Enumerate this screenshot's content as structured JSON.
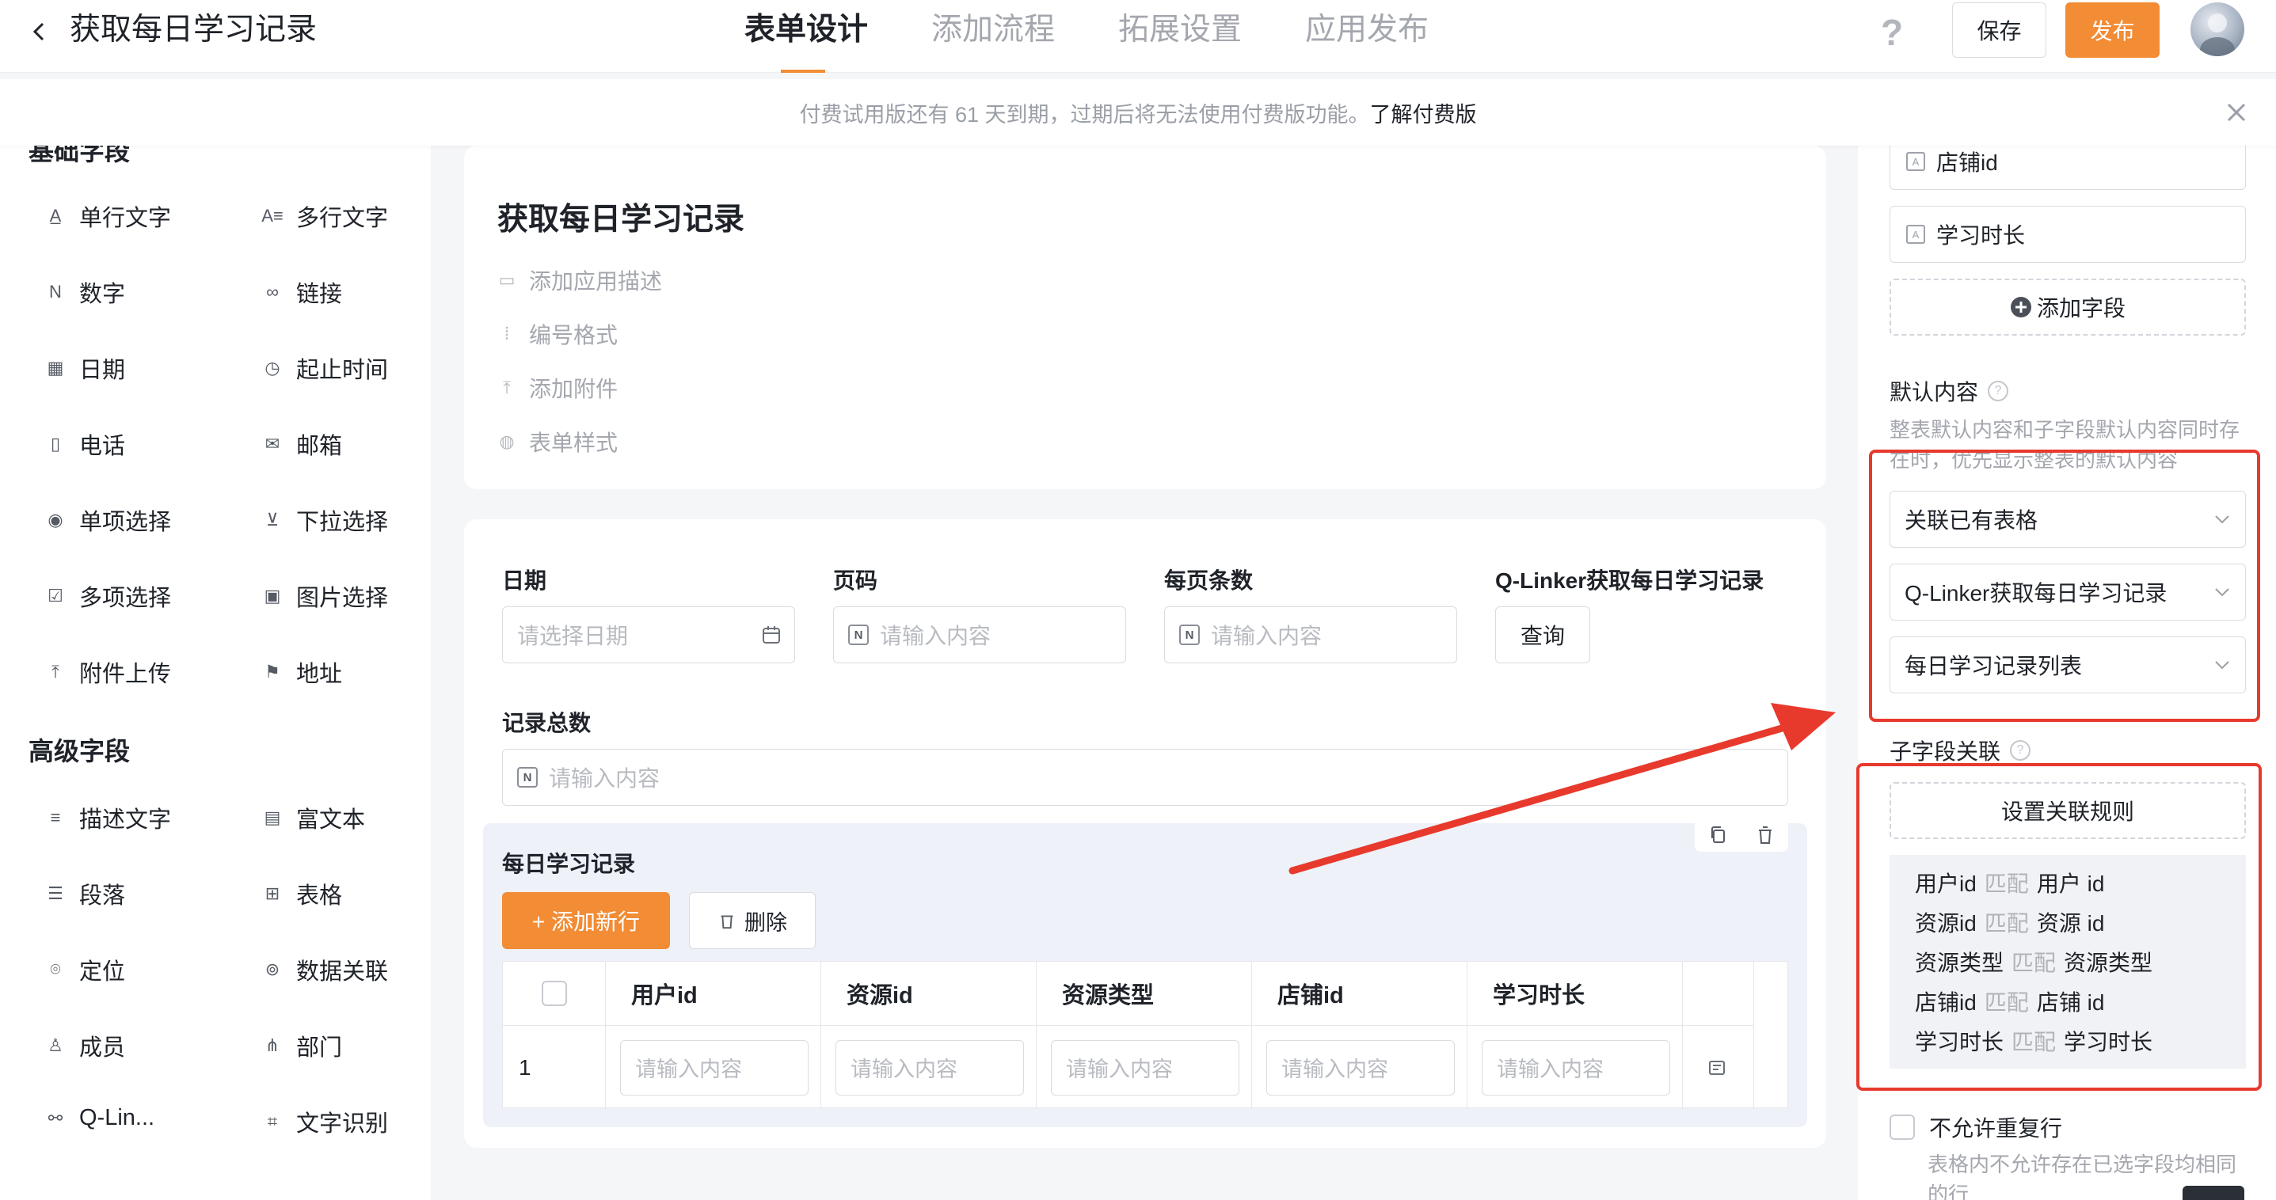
{
  "header": {
    "app_title": "获取每日学习记录",
    "tabs": [
      "表单设计",
      "添加流程",
      "拓展设置",
      "应用发布"
    ],
    "help": "?",
    "save_label": "保存",
    "publish_label": "发布"
  },
  "banner": {
    "text": "付费试用版还有 61 天到期，过期后将无法使用付费版功能。",
    "link": "了解付费版"
  },
  "left_panel": {
    "basic_group_title": "基础字段",
    "basic_fields": [
      {
        "label": "单行文字",
        "icon": "single-line-text-icon"
      },
      {
        "label": "多行文字",
        "icon": "multi-line-text-icon"
      },
      {
        "label": "数字",
        "icon": "number-icon"
      },
      {
        "label": "链接",
        "icon": "link-icon"
      },
      {
        "label": "日期",
        "icon": "calendar-icon"
      },
      {
        "label": "起止时间",
        "icon": "time-range-icon"
      },
      {
        "label": "电话",
        "icon": "phone-icon"
      },
      {
        "label": "邮箱",
        "icon": "mail-icon"
      },
      {
        "label": "单项选择",
        "icon": "radio-icon"
      },
      {
        "label": "下拉选择",
        "icon": "dropdown-icon"
      },
      {
        "label": "多项选择",
        "icon": "checkbox-icon"
      },
      {
        "label": "图片选择",
        "icon": "image-icon"
      },
      {
        "label": "附件上传",
        "icon": "upload-icon"
      },
      {
        "label": "地址",
        "icon": "address-icon"
      }
    ],
    "advanced_group_title": "高级字段",
    "advanced_fields": [
      {
        "label": "描述文字",
        "icon": "description-icon"
      },
      {
        "label": "富文本",
        "icon": "rich-text-icon"
      },
      {
        "label": "段落",
        "icon": "paragraph-icon"
      },
      {
        "label": "表格",
        "icon": "table-icon"
      },
      {
        "label": "定位",
        "icon": "location-icon"
      },
      {
        "label": "数据关联",
        "icon": "data-link-icon"
      },
      {
        "label": "成员",
        "icon": "member-icon"
      },
      {
        "label": "部门",
        "icon": "department-icon"
      },
      {
        "label": "Q-Lin...",
        "icon": "q-linker-icon"
      },
      {
        "label": "文字识别",
        "icon": "ocr-icon"
      }
    ]
  },
  "form": {
    "title": "获取每日学习记录",
    "meta_items": [
      "添加应用描述",
      "编号格式",
      "添加附件",
      "表单样式"
    ],
    "fields": {
      "date": {
        "label": "日期",
        "placeholder": "请选择日期"
      },
      "page": {
        "label": "页码",
        "placeholder": "请输入内容"
      },
      "page_size": {
        "label": "每页条数",
        "placeholder": "请输入内容"
      },
      "qlinker": {
        "label": "Q-Linker获取每日学习记录",
        "button": "查询"
      },
      "total": {
        "label": "记录总数",
        "placeholder": "请输入内容"
      }
    },
    "subform": {
      "title": "每日学习记录",
      "add_row": "+ 添加新行",
      "delete": "删除",
      "columns": [
        "用户id",
        "资源id",
        "资源类型",
        "店铺id",
        "学习时长"
      ],
      "row_number": "1",
      "cell_placeholder": "请输入内容"
    }
  },
  "right_panel": {
    "sub_fields": [
      "店铺id",
      "学习时长"
    ],
    "add_field": "添加字段",
    "default_content_label": "默认内容",
    "default_content_desc": "整表默认内容和子字段默认内容同时存在时，优先显示整表的默认内容",
    "selects": [
      "关联已有表格",
      "Q-Linker获取每日学习记录",
      "每日学习记录列表"
    ],
    "sub_link_label": "子字段关联",
    "set_rule_button": "设置关联规则",
    "match_word": "匹配",
    "rules": [
      {
        "left": "用户id",
        "right": "用户 id"
      },
      {
        "left": "资源id",
        "right": "资源 id"
      },
      {
        "left": "资源类型",
        "right": "资源类型"
      },
      {
        "left": "店铺id",
        "right": "店铺 id"
      },
      {
        "left": "学习时长",
        "right": "学习时长"
      }
    ],
    "no_duplicate_label": "不允许重复行",
    "no_duplicate_desc": "表格内不允许存在已选字段均相同的行"
  },
  "colors": {
    "accent": "#f28c35",
    "annotation": "#e8392d"
  }
}
